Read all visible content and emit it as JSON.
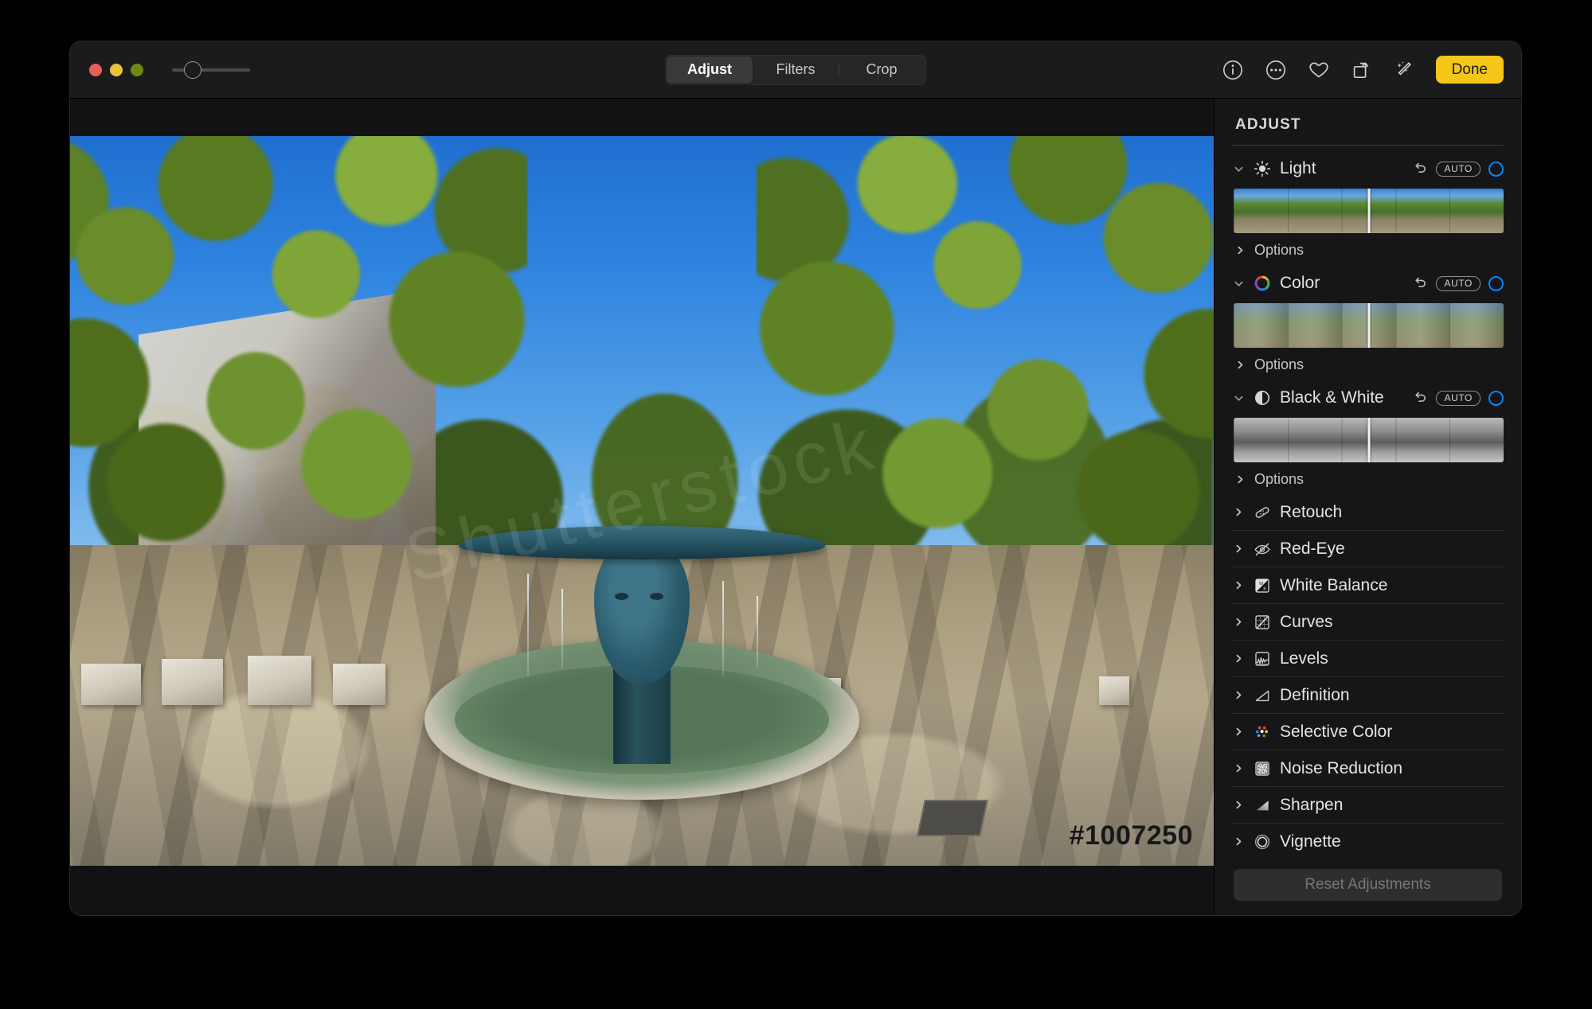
{
  "window": {
    "traffic_lights": [
      {
        "name": "close",
        "color": "#e8605a"
      },
      {
        "name": "minimize",
        "color": "#e8c33c"
      },
      {
        "name": "zoom",
        "color": "#6e8a16"
      }
    ],
    "zoom_slider": {
      "name": "zoom-slider",
      "value_percent": 20
    }
  },
  "toolbar": {
    "segments": [
      {
        "label": "Adjust",
        "active": true
      },
      {
        "label": "Filters",
        "active": false
      },
      {
        "label": "Crop",
        "active": false
      }
    ],
    "icons": [
      {
        "name": "info-icon",
        "glyph": "i"
      },
      {
        "name": "more-options-icon",
        "glyph": "..."
      },
      {
        "name": "favorite-heart-icon",
        "glyph": "heart"
      },
      {
        "name": "rotate-icon",
        "glyph": "rotate"
      },
      {
        "name": "auto-enhance-icon",
        "glyph": "wand"
      }
    ],
    "done_label": "Done",
    "done_color": "#f5c518"
  },
  "photo": {
    "watermark_id": "#1007250",
    "watermark_text": "Shutterstock",
    "description": "Park plaza with bronze face sculpture fountain, trees and stone benches"
  },
  "panel": {
    "title": "ADJUST",
    "accent_color": "#0a84ff",
    "groups": [
      {
        "name": "light",
        "label": "Light",
        "icon": "sun-icon",
        "expanded": true,
        "revert": "revert-icon",
        "auto_label": "AUTO",
        "toggle_on": true,
        "filmstrip": "color",
        "options_label": "Options"
      },
      {
        "name": "color",
        "label": "Color",
        "icon": "color-wheel-icon",
        "expanded": true,
        "revert": "revert-icon",
        "auto_label": "AUTO",
        "toggle_on": true,
        "filmstrip": "mono-fade",
        "options_label": "Options"
      },
      {
        "name": "black-and-white",
        "label": "Black & White",
        "icon": "contrast-circle-icon",
        "expanded": true,
        "revert": "revert-icon",
        "auto_label": "AUTO",
        "toggle_on": true,
        "filmstrip": "mono",
        "options_label": "Options"
      }
    ],
    "rows": [
      {
        "name": "retouch",
        "label": "Retouch",
        "icon": "bandage-icon"
      },
      {
        "name": "red-eye",
        "label": "Red-Eye",
        "icon": "eye-slash-icon"
      },
      {
        "name": "white-balance",
        "label": "White Balance",
        "icon": "white-balance-icon"
      },
      {
        "name": "curves",
        "label": "Curves",
        "icon": "curves-icon"
      },
      {
        "name": "levels",
        "label": "Levels",
        "icon": "levels-icon"
      },
      {
        "name": "definition",
        "label": "Definition",
        "icon": "definition-icon"
      },
      {
        "name": "selective-color",
        "label": "Selective Color",
        "icon": "selective-color-icon"
      },
      {
        "name": "noise-reduction",
        "label": "Noise Reduction",
        "icon": "noise-reduction-icon"
      },
      {
        "name": "sharpen",
        "label": "Sharpen",
        "icon": "sharpen-icon"
      },
      {
        "name": "vignette",
        "label": "Vignette",
        "icon": "vignette-icon"
      }
    ],
    "reset_label": "Reset Adjustments",
    "reset_enabled": false
  }
}
